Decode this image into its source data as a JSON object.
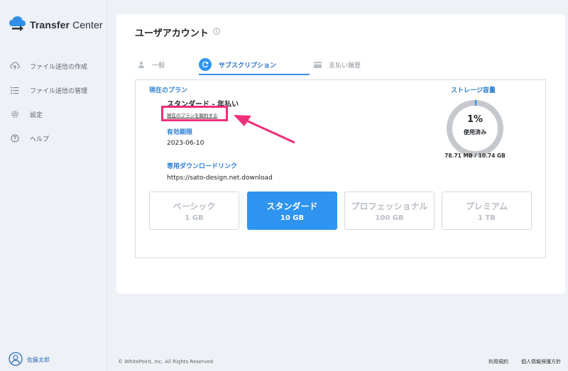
{
  "app": {
    "name_bold": "Transfer",
    "name_rest": "Center",
    "accent": "#2f94ef",
    "highlight_color": "#ee2f7c"
  },
  "sidebar": {
    "items": [
      {
        "label": "ファイル送信の作成",
        "icon": "upload-cloud-icon"
      },
      {
        "label": "ファイル送信の管理",
        "icon": "list-icon"
      },
      {
        "label": "設定",
        "icon": "gear-icon"
      },
      {
        "label": "ヘルプ",
        "icon": "help-circle-icon"
      }
    ],
    "user": {
      "name": "佐藤太郎",
      "icon": "user-circle-icon"
    }
  },
  "main": {
    "title": "ユーザアカウント",
    "tabs": [
      {
        "label": "一般",
        "icon": "person-icon",
        "active": false
      },
      {
        "label": "サブスクリプション",
        "icon": "refresh-icon",
        "active": true
      },
      {
        "label": "支払い履歴",
        "icon": "credit-card-icon",
        "active": false
      }
    ],
    "subscription": {
      "current_plan_label": "現在のプラン",
      "plan_name": "スタンダード - 年払い",
      "cancel_link": "現在のプランを解約する",
      "expiry_label": "有効期限",
      "expiry_value": "2023-06-10",
      "download_link_label": "専用ダウンロードリンク",
      "download_link_value": "https://sato-design.net.download",
      "storage_label": "ストレージ容量",
      "usage_percent": "1%",
      "usage_fraction": 0.01,
      "usage_caption": "使用済み",
      "storage_detail": "78.71 MB / 10.74 GB"
    },
    "plans": [
      {
        "name": "ベーシック",
        "size": "1 GB",
        "active": false
      },
      {
        "name": "スタンダード",
        "size": "10 GB",
        "active": true
      },
      {
        "name": "プロフェッショナル",
        "size": "100 GB",
        "active": false
      },
      {
        "name": "プレミアム",
        "size": "1 TB",
        "active": false
      }
    ]
  },
  "footer": {
    "copyright": "© WhitePoint, Inc. All Rights Reserved",
    "terms": "利用規約",
    "privacy": "個人情報保護方針"
  }
}
